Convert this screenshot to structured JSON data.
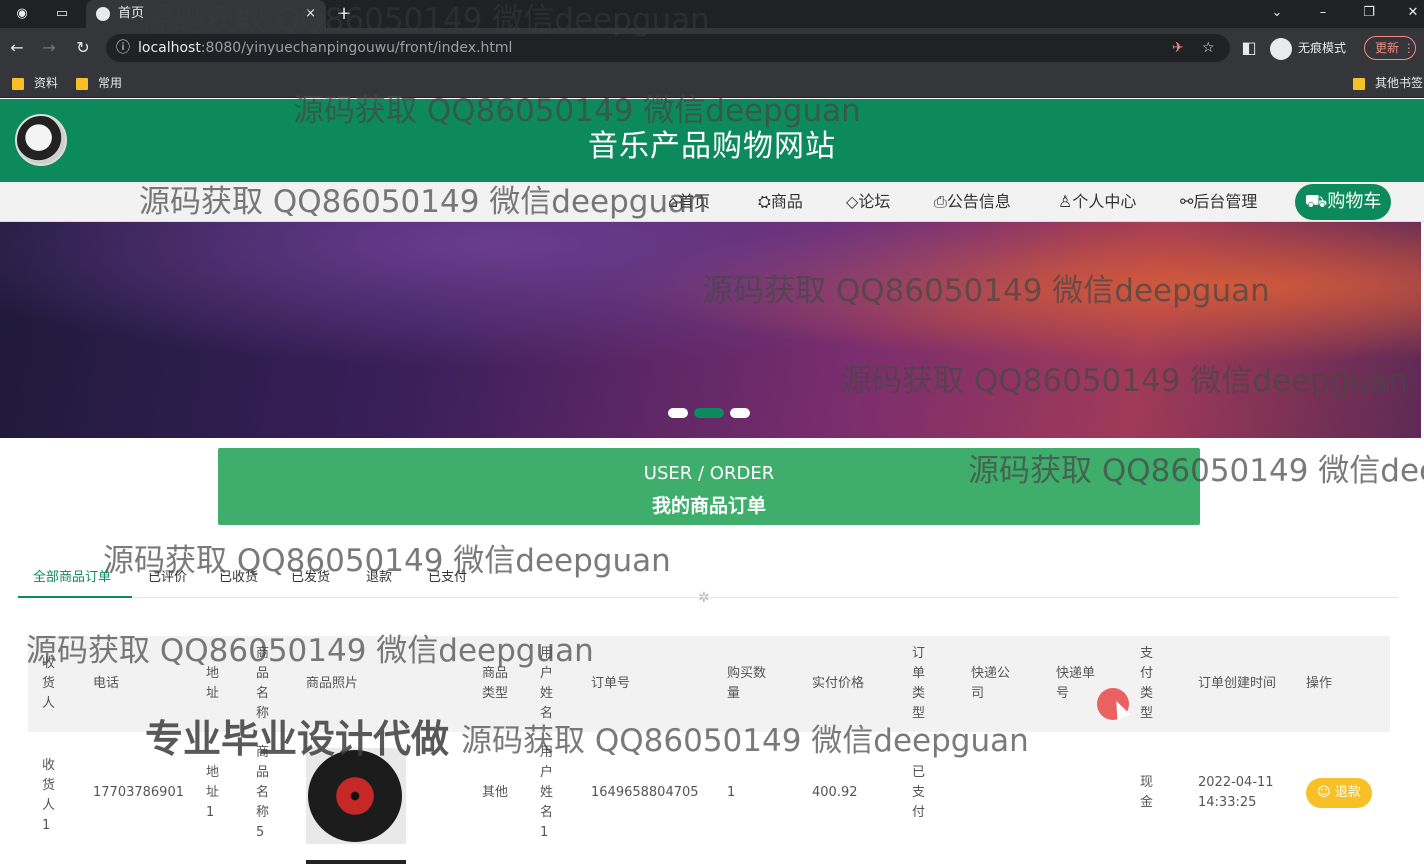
{
  "browser": {
    "tab_title": "首页",
    "tab_close": "×",
    "new_tab": "+",
    "window_controls": [
      "⌄",
      "–",
      "❐",
      "✕"
    ],
    "url_host": "localhost",
    "url_path": ":8080/yinyuechanpingouwu/front/index.html",
    "incognito_label": "无痕模式",
    "update_label": "更新",
    "bookmarks": [
      "资料",
      "常用"
    ],
    "other_bookmarks": "其他书签"
  },
  "site": {
    "title": "音乐产品购物网站",
    "nav": [
      {
        "icon": "home-icon",
        "glyph": "⌂",
        "label": "首页"
      },
      {
        "icon": "goods-icon",
        "glyph": "⛭",
        "label": "商品"
      },
      {
        "icon": "forum-icon",
        "glyph": "◇",
        "label": "论坛"
      },
      {
        "icon": "notice-icon",
        "glyph": "⎙",
        "label": "公告信息"
      },
      {
        "icon": "user-icon",
        "glyph": "♙",
        "label": "个人中心"
      },
      {
        "icon": "admin-icon",
        "glyph": "⚯",
        "label": "后台管理"
      }
    ],
    "cart_label": "购物车"
  },
  "order_banner": {
    "en": "USER / ORDER",
    "zh": "我的商品订单"
  },
  "order_tabs": [
    "全部商品订单",
    "已评价",
    "已收货",
    "已发货",
    "退款",
    "已支付"
  ],
  "active_tab": 0,
  "table": {
    "headers": {
      "receiver": "收货人",
      "phone": "电话",
      "address": "地址",
      "product_name": "商品名称",
      "photo": "商品照片",
      "type": "商品类型",
      "username": "用户姓名",
      "order_no": "订单号",
      "qty": "购买数量",
      "price": "实付价格",
      "order_type": "订单类型",
      "courier": "快递公司",
      "tracking": "快递单号",
      "pay_type": "支付类型",
      "created": "订单创建时间",
      "action": "操作"
    },
    "rows": [
      {
        "receiver": "收货人1",
        "phone": "17703786901",
        "address": "地址1",
        "product_name": "商品名称5",
        "type": "其他",
        "username": "用户姓名1",
        "order_no": "1649658804705",
        "qty": "1",
        "price": "400.92",
        "order_type": "已支付",
        "courier": "",
        "tracking": "",
        "pay_type": "现金",
        "created": "2022-04-11 14:33:25",
        "action_label": "退款"
      }
    ]
  },
  "watermarks": {
    "text": "源码获取 QQ86050149 微信deepguan",
    "text_clipped": "源码获取 QQ86050149 微信deep",
    "bold": "专业毕业设计代做"
  },
  "colors": {
    "brand": "#0d8a5d",
    "order_banner": "#3fae6d",
    "refund_button": "#f6c026"
  }
}
